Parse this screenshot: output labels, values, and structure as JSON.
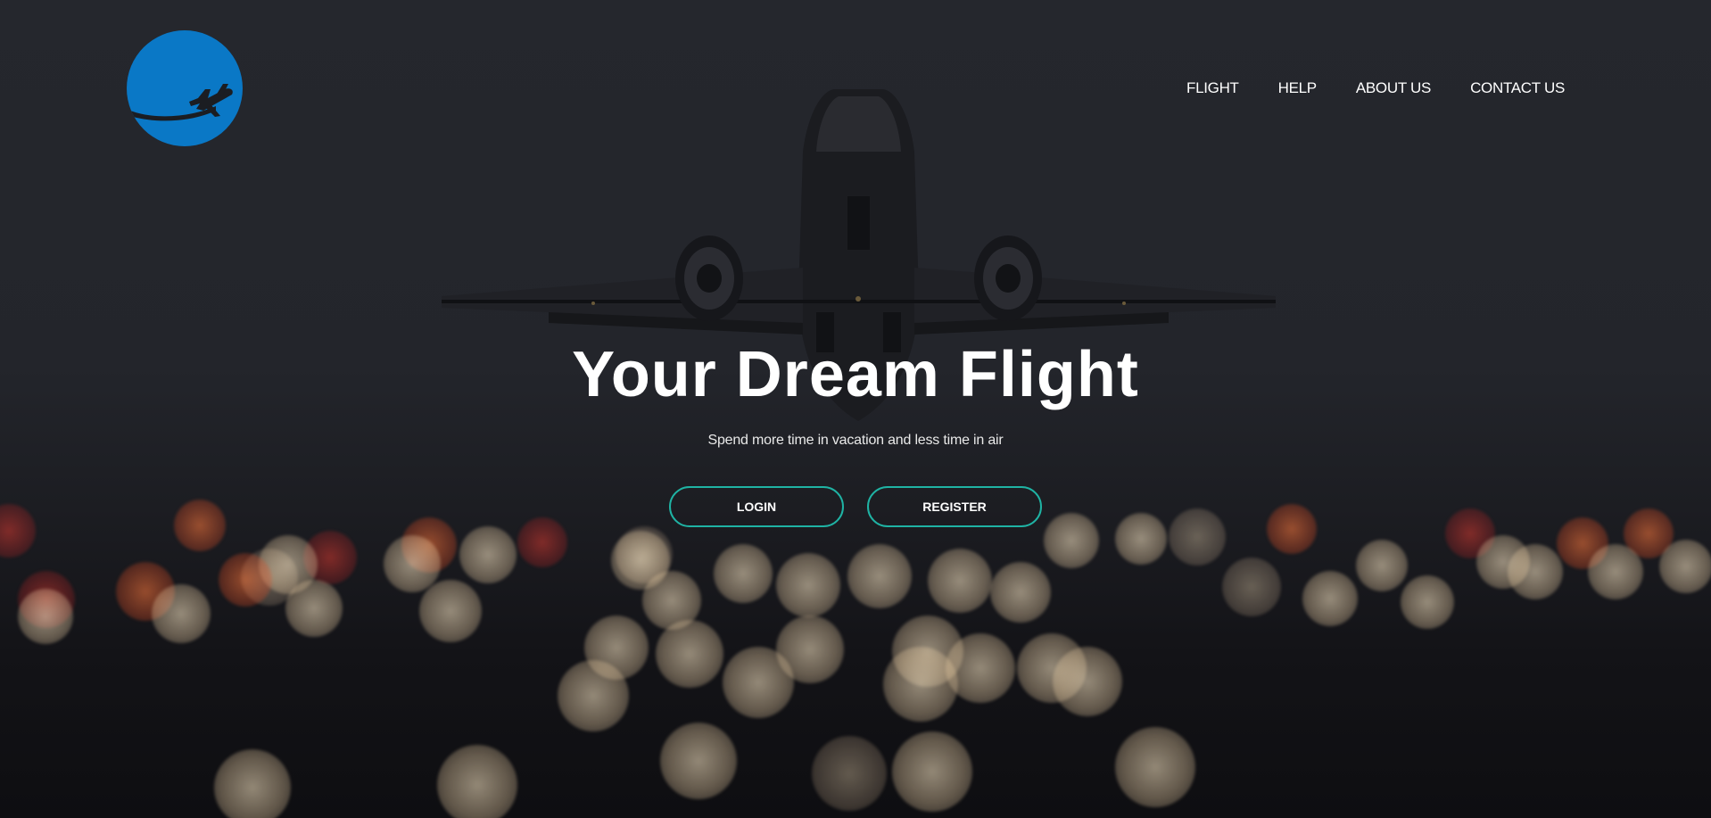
{
  "brand": {
    "logo_icon": "airplane-globe-logo",
    "logo_color": "#0a78c6"
  },
  "nav": {
    "items": [
      {
        "label": "FLIGHT"
      },
      {
        "label": "HELP"
      },
      {
        "label": "ABOUT US"
      },
      {
        "label": "CONTACT US"
      }
    ]
  },
  "hero": {
    "title": "Your Dream Flight",
    "subtitle": "Spend more time in vacation and less time in air",
    "login_label": "LOGIN",
    "register_label": "REGISTER",
    "button_border_color": "#1fb3a4"
  }
}
